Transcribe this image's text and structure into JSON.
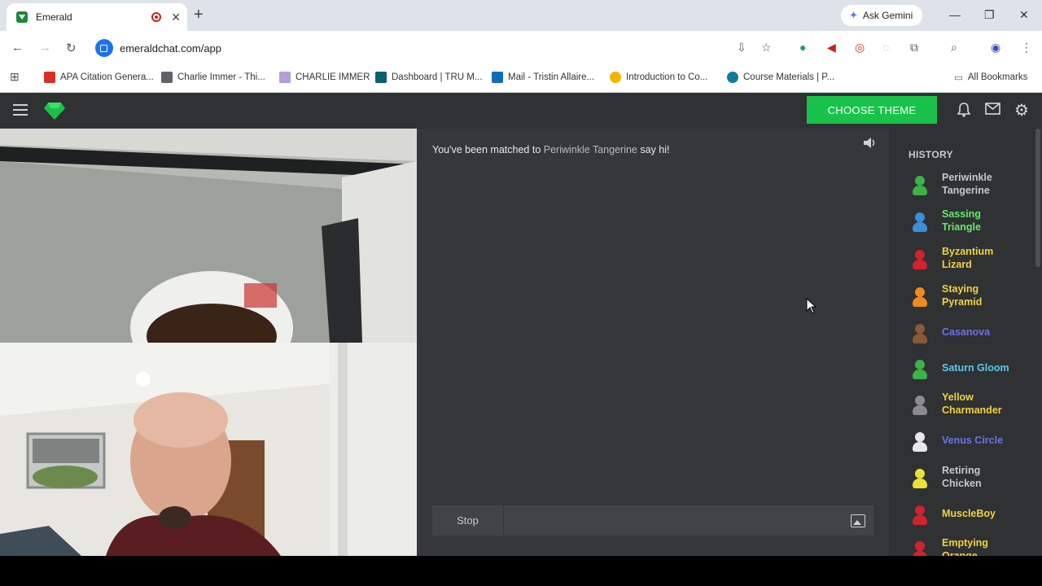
{
  "browser": {
    "tab_title": "Emerald",
    "new_tab_label": "+",
    "ask_gemini": "Ask Gemini",
    "url": "emeraldchat.com/app",
    "bookmarks": [
      {
        "label": "APA Citation Genera...",
        "color": "#d93025"
      },
      {
        "label": "Charlie Immer - Thi...",
        "color": "#5f6368"
      },
      {
        "label": "CHARLIE IMMER",
        "color": "#b39ddb"
      },
      {
        "label": "Dashboard | TRU M...",
        "color": "#0b5f6e"
      },
      {
        "label": "Mail - Tristin Allaire...",
        "color": "#0f6cbd"
      },
      {
        "label": "Introduction to Co...",
        "color": "#f4b400"
      },
      {
        "label": "Course Materials | P...",
        "color": "#127a9c"
      }
    ],
    "all_bookmarks": "All Bookmarks"
  },
  "app": {
    "choose_theme": "CHOOSE THEME",
    "chat": {
      "match_prefix": "You've been matched to",
      "match_name": "Periwinkle Tangerine",
      "match_suffix": "say hi!",
      "stop_label": "Stop",
      "message_placeholder": ""
    },
    "history": {
      "title": "HISTORY",
      "items": [
        {
          "name": "Periwinkle Tangerine",
          "color": "#c6c9cc",
          "avatar": "#3db24a"
        },
        {
          "name": "Sassing Triangle",
          "color": "#67e86b",
          "avatar": "#3b8fd6"
        },
        {
          "name": "Byzantium Lizard",
          "color": "#f2d23b",
          "avatar": "#d0242c"
        },
        {
          "name": "Staying Pyramid",
          "color": "#f2d23b",
          "avatar": "#f08a1c"
        },
        {
          "name": "Casanova",
          "color": "#6b74e8",
          "avatar": "#8a5a3c"
        },
        {
          "name": "Saturn Gloom",
          "color": "#5cc8f0",
          "avatar": "#3db24a"
        },
        {
          "name": "Yellow Charmander",
          "color": "#f2d23b",
          "avatar": "#8c8c8c"
        },
        {
          "name": "Venus Circle",
          "color": "#6b74e8",
          "avatar": "#e8e8e8"
        },
        {
          "name": "Retiring Chicken",
          "color": "#c6c9cc",
          "avatar": "#e8e23b"
        },
        {
          "name": "MuscleBoy",
          "color": "#f2d23b",
          "avatar": "#d0242c"
        },
        {
          "name": "Emptying Orange",
          "color": "#f2d23b",
          "avatar": "#d0242c"
        }
      ]
    }
  }
}
